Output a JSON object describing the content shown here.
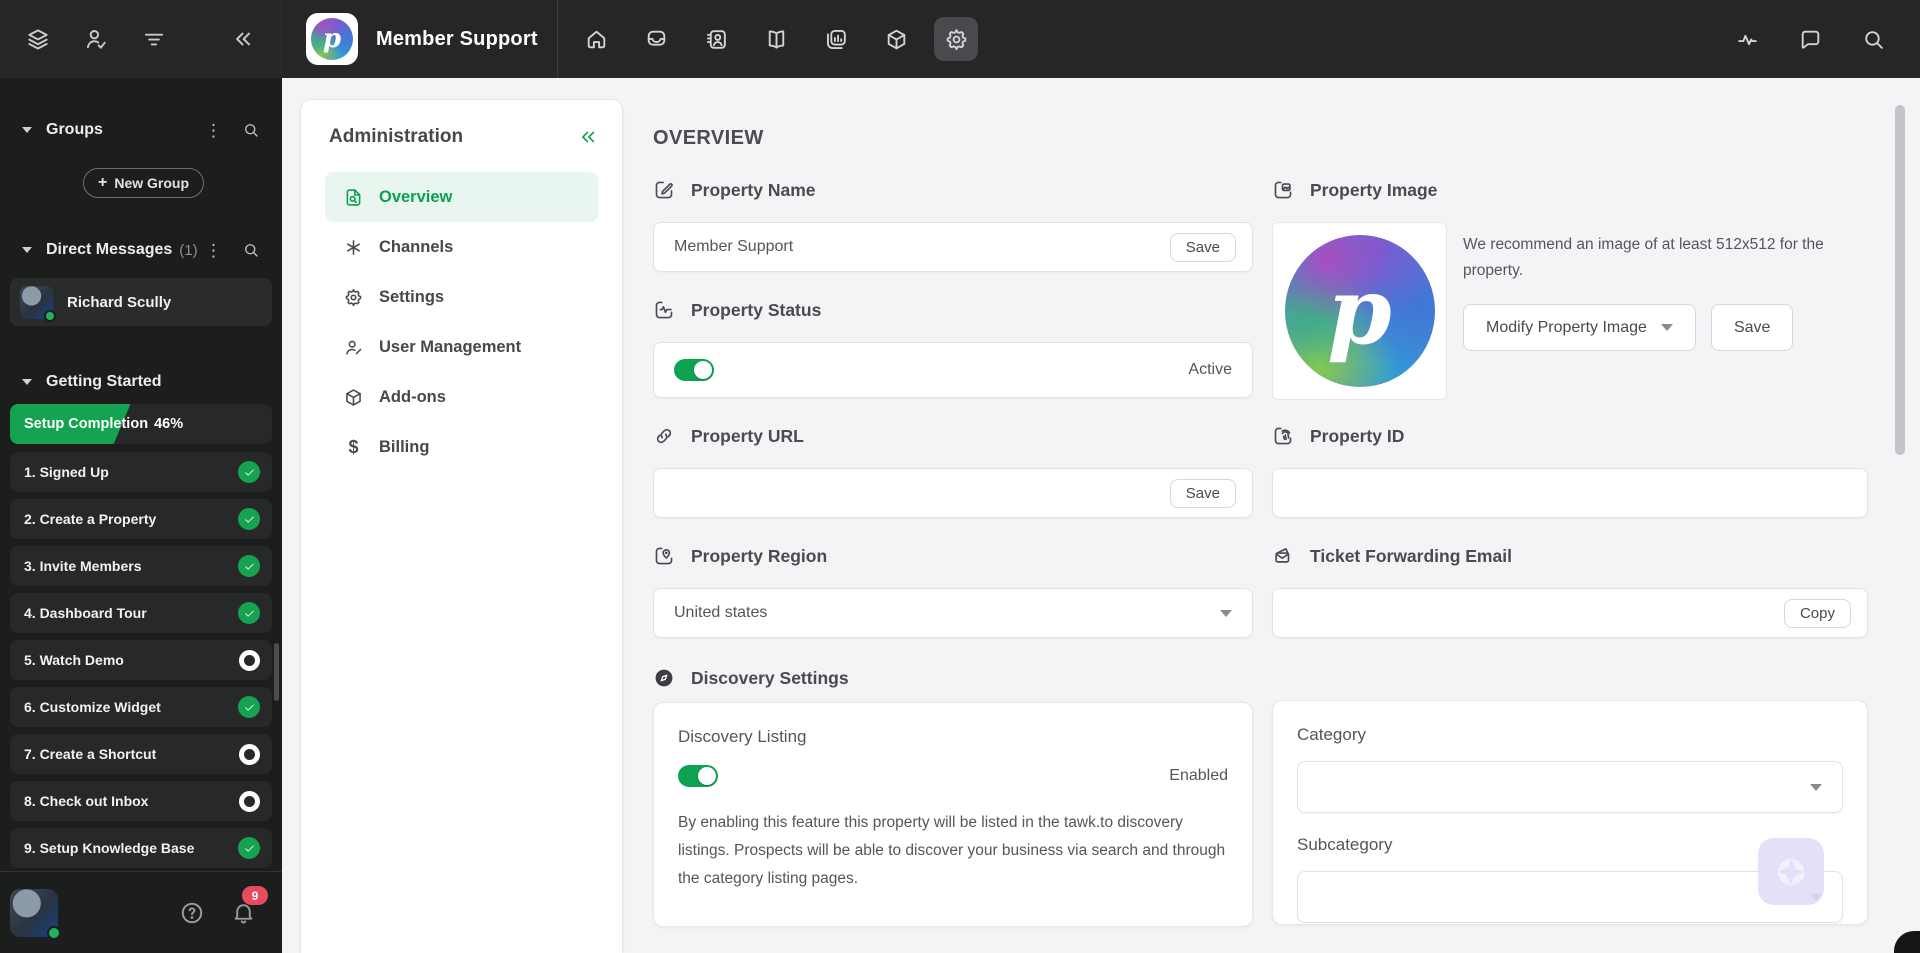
{
  "topbar": {
    "property_title": "Member Support",
    "logo_letter": "p",
    "left_icons": [
      "groups-icon",
      "agents-icon",
      "filter-icon",
      "collapse-sidebar-icon"
    ],
    "nav_icons": [
      "home-icon",
      "inbox-icon",
      "contacts-icon",
      "knowledge-base-icon",
      "reporting-icon",
      "addons-icon",
      "settings-icon"
    ],
    "active_nav": "settings-icon",
    "right_icons": [
      "activity-icon",
      "messages-icon",
      "search-icon"
    ]
  },
  "sidebar": {
    "groups": {
      "label": "Groups",
      "new_group_label": "New Group"
    },
    "direct_messages": {
      "label": "Direct Messages",
      "count": "(1)",
      "items": [
        {
          "name": "Richard Scully",
          "online": true
        }
      ]
    },
    "getting_started": {
      "label": "Getting Started",
      "progress_label": "Setup Completion",
      "progress_value": "46%",
      "progress_pct": 46,
      "steps": [
        {
          "label": "1. Signed Up",
          "done": true
        },
        {
          "label": "2. Create a Property",
          "done": true
        },
        {
          "label": "3. Invite Members",
          "done": true
        },
        {
          "label": "4. Dashboard Tour",
          "done": true
        },
        {
          "label": "5. Watch Demo",
          "done": false
        },
        {
          "label": "6. Customize Widget",
          "done": true
        },
        {
          "label": "7. Create a Shortcut",
          "done": false
        },
        {
          "label": "8. Check out Inbox",
          "done": false
        },
        {
          "label": "9. Setup Knowledge Base",
          "done": true
        }
      ]
    },
    "bottom": {
      "notifications_count": "9"
    }
  },
  "admin_panel": {
    "title": "Administration",
    "items": [
      {
        "label": "Overview",
        "icon": "overview-icon",
        "active": true
      },
      {
        "label": "Channels",
        "icon": "channels-icon",
        "active": false
      },
      {
        "label": "Settings",
        "icon": "settings-icon",
        "active": false
      },
      {
        "label": "User Management",
        "icon": "user-management-icon",
        "active": false
      },
      {
        "label": "Add-ons",
        "icon": "addons-icon",
        "active": false
      },
      {
        "label": "Billing",
        "icon": "billing-icon",
        "active": false
      }
    ]
  },
  "main": {
    "title": "OVERVIEW",
    "property_name": {
      "label": "Property Name",
      "value": "Member Support",
      "save_label": "Save"
    },
    "property_status": {
      "label": "Property Status",
      "enabled": true,
      "status_text": "Active"
    },
    "property_url": {
      "label": "Property URL",
      "value": "",
      "save_label": "Save"
    },
    "property_region": {
      "label": "Property Region",
      "value": "United states"
    },
    "property_image": {
      "label": "Property Image",
      "hint": "We recommend an image of at least 512x512 for the property.",
      "modify_label": "Modify Property Image",
      "save_label": "Save",
      "logo_letter": "p"
    },
    "property_id": {
      "label": "Property ID",
      "value": ""
    },
    "ticket_forwarding": {
      "label": "Ticket Forwarding Email",
      "value": "",
      "copy_label": "Copy"
    },
    "discovery": {
      "label": "Discovery Settings",
      "listing": {
        "title": "Discovery Listing",
        "enabled": true,
        "status_text": "Enabled",
        "description": "By enabling this feature this property will be listed in the tawk.to discovery listings. Prospects will be able to discover your business via search and through the category listing pages."
      },
      "category_label": "Category",
      "category_value": "",
      "subcategory_label": "Subcategory",
      "subcategory_value": ""
    }
  },
  "colors": {
    "accent_green": "#0fa351",
    "accent_green_bg": "#e9f6ef",
    "topbar_bg": "#262626",
    "sidebar_bg": "#1c1d1d",
    "badge_red": "#e84a5f"
  }
}
